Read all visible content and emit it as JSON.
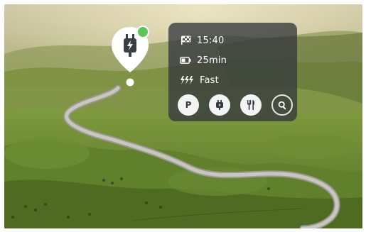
{
  "charger_pin": {
    "icon": "ev-charger-icon",
    "status": "available",
    "status_color": "#5cc65a"
  },
  "info_card": {
    "distance": {
      "icon": "finish-flag-icon",
      "text": "15:40"
    },
    "charge_time": {
      "icon": "battery-icon",
      "text": "25min"
    },
    "charge_speed": {
      "icon": "fast-charge-icon",
      "text": "Fast"
    },
    "actions": [
      {
        "id": "parking",
        "icon": "parking-icon",
        "label": "P"
      },
      {
        "id": "charger",
        "icon": "ev-plug-icon",
        "label": ""
      },
      {
        "id": "restaurant",
        "icon": "fork-knife-icon",
        "label": ""
      },
      {
        "id": "search",
        "icon": "search-icon",
        "label": ""
      }
    ]
  },
  "colors": {
    "card_bg": "#34383c",
    "accent_green": "#5cc65a"
  }
}
